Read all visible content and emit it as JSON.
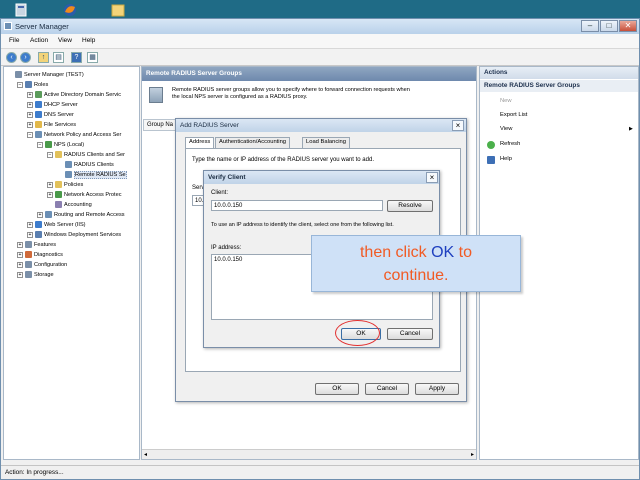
{
  "taskbar": {
    "icons": [
      "server-manager-icon",
      "firefox-icon",
      "folder-icon"
    ]
  },
  "window": {
    "title": "Server Manager",
    "controls": {
      "minimize": "–",
      "maximize": "□",
      "close": "✕"
    }
  },
  "menu": {
    "file": "File",
    "action": "Action",
    "view": "View",
    "help": "Help"
  },
  "toolbar": {
    "buttons": [
      "back-arrow-icon",
      "forward-arrow-icon",
      "up-folder-icon",
      "console-icon",
      "help-icon",
      "properties-icon"
    ]
  },
  "tree": {
    "items": [
      {
        "label": "Server Manager (TEST)",
        "icon": "server-icon",
        "depth": 0,
        "expander": ""
      },
      {
        "label": "Roles",
        "icon": "roles-icon",
        "depth": 1,
        "expander": "−"
      },
      {
        "label": "Active Directory Domain Servic",
        "icon": "ad-icon",
        "depth": 2,
        "expander": "+"
      },
      {
        "label": "DHCP Server",
        "icon": "dhcp-icon",
        "depth": 2,
        "expander": "+"
      },
      {
        "label": "DNS Server",
        "icon": "dns-icon",
        "depth": 2,
        "expander": "+"
      },
      {
        "label": "File Services",
        "icon": "file-services-icon",
        "depth": 2,
        "expander": "+"
      },
      {
        "label": "Network Policy and Access Ser",
        "icon": "npas-icon",
        "depth": 2,
        "expander": "−"
      },
      {
        "label": "NPS (Local)",
        "icon": "nps-icon",
        "depth": 3,
        "expander": "−"
      },
      {
        "label": "RADIUS Clients and Ser",
        "icon": "folder-icon",
        "depth": 4,
        "expander": "−"
      },
      {
        "label": "RADIUS Clients",
        "icon": "radius-clients-icon",
        "depth": 5,
        "expander": ""
      },
      {
        "label": "Remote RADIUS Se",
        "icon": "remote-radius-icon",
        "depth": 5,
        "expander": "",
        "selected": true
      },
      {
        "label": "Policies",
        "icon": "folder-icon",
        "depth": 4,
        "expander": "+"
      },
      {
        "label": "Network Access Protec",
        "icon": "nap-icon",
        "depth": 4,
        "expander": "+"
      },
      {
        "label": "Accounting",
        "icon": "accounting-icon",
        "depth": 4,
        "expander": ""
      },
      {
        "label": "Routing and Remote Access",
        "icon": "routing-icon",
        "depth": 3,
        "expander": "+"
      },
      {
        "label": "Web Server (IIS)",
        "icon": "iis-icon",
        "depth": 2,
        "expander": "+"
      },
      {
        "label": "Windows Deployment Services",
        "icon": "wds-icon",
        "depth": 2,
        "expander": "+"
      },
      {
        "label": "Features",
        "icon": "features-icon",
        "depth": 1,
        "expander": "+"
      },
      {
        "label": "Diagnostics",
        "icon": "diagnostics-icon",
        "depth": 1,
        "expander": "+"
      },
      {
        "label": "Configuration",
        "icon": "configuration-icon",
        "depth": 1,
        "expander": "+"
      },
      {
        "label": "Storage",
        "icon": "storage-icon",
        "depth": 1,
        "expander": "+"
      }
    ]
  },
  "center": {
    "header": "Remote RADIUS Server Groups",
    "description_line1": "Remote RADIUS server groups allow you to specify where to forward connection requests when",
    "description_line2": "the local NPS server is configured as a RADIUS proxy.",
    "column_header": "Group Na"
  },
  "actions_pane": {
    "header": "Actions",
    "section": "Remote RADIUS Server Groups",
    "items": [
      {
        "label": "New",
        "enabled": false
      },
      {
        "label": "Export List",
        "enabled": true
      },
      {
        "label": "View",
        "enabled": true,
        "submenu": "▶"
      },
      {
        "label": "Refresh",
        "enabled": true
      },
      {
        "label": "Help",
        "enabled": true
      }
    ]
  },
  "status": {
    "text": "Action:  In progress..."
  },
  "add_radius_dialog": {
    "title": "Add RADIUS Server",
    "tabs": [
      "Address",
      "Authentication/Accounting",
      "Load Balancing"
    ],
    "instruction": "Type the name or IP address of the RADIUS server you want to add.",
    "server_label": "Serv",
    "server_value": "10.",
    "ok": "OK",
    "cancel": "Cancel",
    "apply": "Apply"
  },
  "verify_dialog": {
    "title": "Verify Client",
    "client_label": "Client:",
    "client_value": "10.0.0.150",
    "resolve": "Resolve",
    "hint": "To use an IP address to identify the client, select one from the following list.",
    "ip_label": "IP address:",
    "ip_list": [
      "10.0.0.150"
    ],
    "ok": "OK",
    "cancel": "Cancel"
  },
  "callout": {
    "pre": "then click ",
    "highlight": "OK",
    "post": " to",
    "line2": "continue.",
    "text_color": "#f15a24",
    "highlight_color": "#1e3fbf"
  }
}
